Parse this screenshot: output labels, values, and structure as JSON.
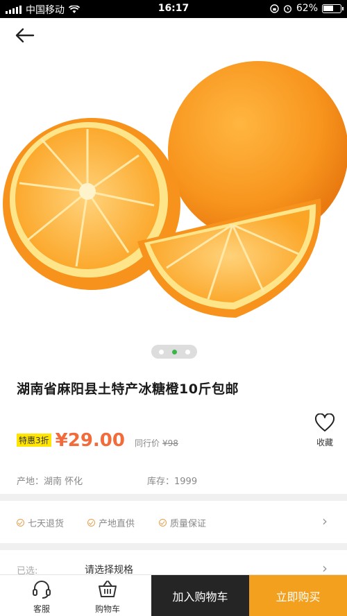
{
  "status_bar": {
    "carrier": "中国移动",
    "time": "16:17",
    "battery": "62%",
    "battery_level": 0.62
  },
  "carousel": {
    "count": 3,
    "active_index": 1
  },
  "product": {
    "title": "湖南省麻阳县土特产冰糖橙10斤包邮",
    "promo_tag": "特惠3折",
    "price": "¥29.00",
    "peer_price_label": "同行价",
    "peer_price": "¥98",
    "favorite_label": "收藏",
    "origin_label": "产地：",
    "origin_value": "湖南 怀化",
    "stock_label": "库存：",
    "stock_value": "1999"
  },
  "guarantees": [
    "七天退货",
    "产地直供",
    "质量保证"
  ],
  "spec": {
    "label": "已选:",
    "value": "请选择规格"
  },
  "bottom_bar": {
    "service_label": "客服",
    "cart_label": "购物车",
    "add_to_cart": "加入购物车",
    "buy_now": "立即购买"
  },
  "colors": {
    "price": "#f26b3a",
    "promo_bg": "#ffe500",
    "buy_bg": "#f3a01e",
    "cart_bg": "#252525",
    "dot_active": "#39b54a"
  }
}
